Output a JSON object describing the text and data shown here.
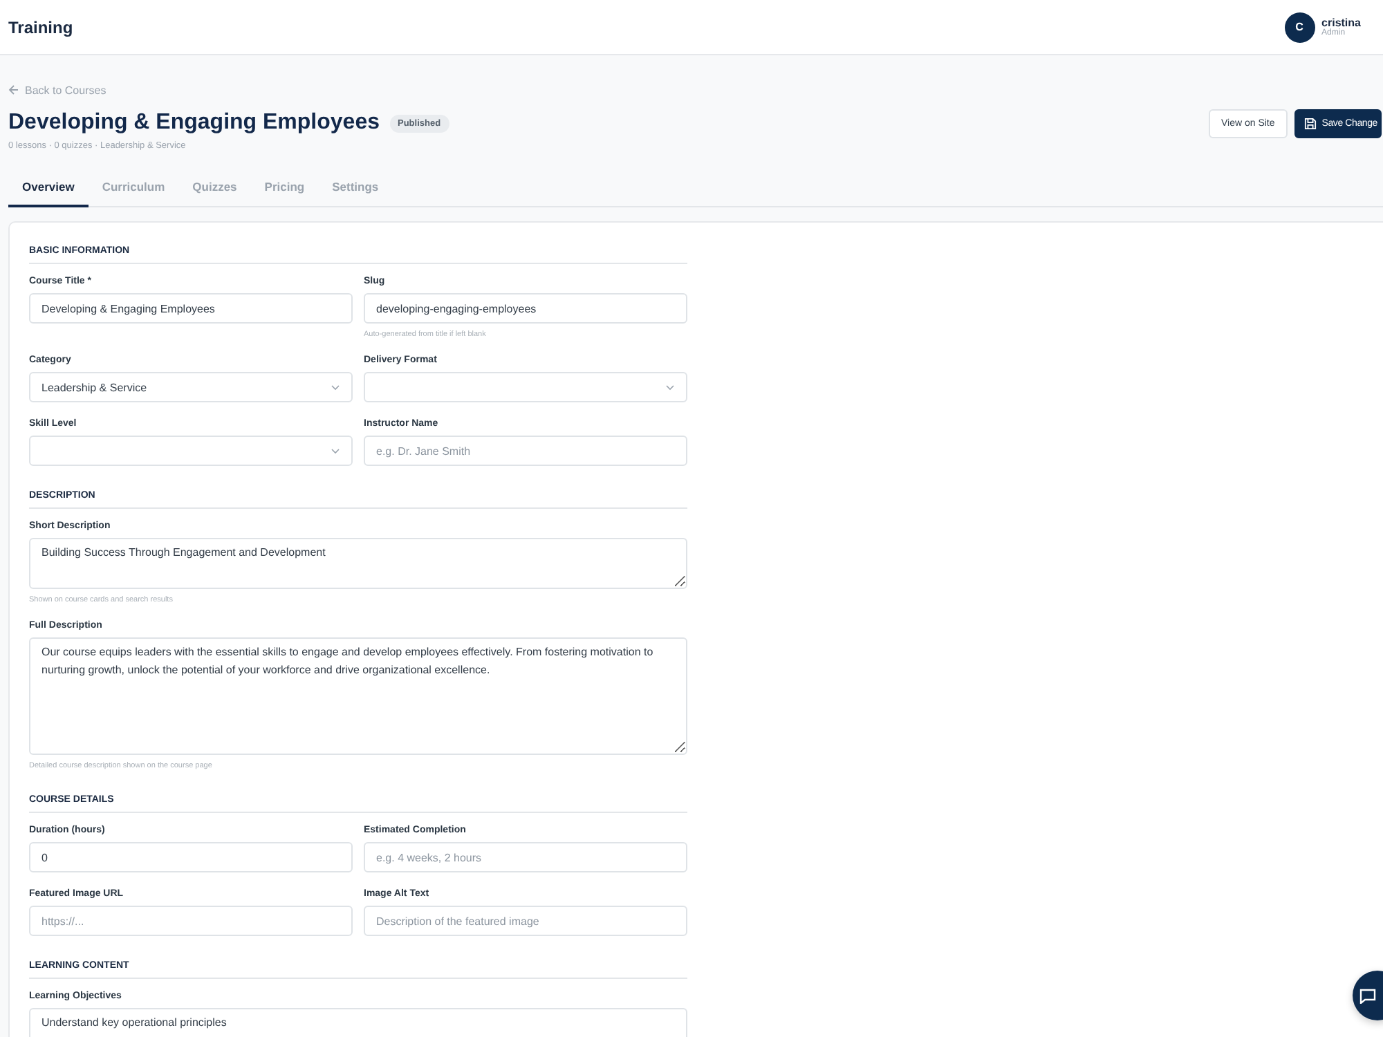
{
  "header": {
    "title": "Training",
    "user": {
      "initial": "C",
      "name": "cristina",
      "role": "Admin"
    }
  },
  "course": {
    "back": "Back to Courses",
    "title": "Developing & Engaging Employees",
    "status": "Published",
    "meta": "0 lessons · 0 quizzes · Leadership & Service",
    "actions": [
      {
        "label": "View on Site",
        "kind": "secondary"
      },
      {
        "label": "Save Change",
        "kind": "primary"
      }
    ]
  },
  "tabs": [
    {
      "label": "Overview",
      "selected": true
    },
    {
      "label": "Curriculum",
      "selected": false
    },
    {
      "label": "Quizzes",
      "selected": false
    },
    {
      "label": "Pricing",
      "selected": false
    },
    {
      "label": "Settings",
      "selected": false
    }
  ],
  "sections": [
    {
      "heading": "BASIC INFORMATION",
      "rows": [
        [
          {
            "label": "Course Title *",
            "kind": "text",
            "value": "Developing & Engaging Employees"
          },
          {
            "label": "Slug",
            "kind": "text",
            "value": "developing-engaging-employees",
            "help": "Auto-generated from title if left blank"
          }
        ],
        [
          {
            "label": "Category",
            "kind": "select",
            "value": "Leadership & Service"
          },
          {
            "label": "Delivery Format",
            "kind": "select"
          }
        ],
        [
          {
            "label": "Skill Level",
            "kind": "select"
          },
          {
            "label": "Instructor Name",
            "kind": "text",
            "placeholder": "e.g. Dr. Jane Smith"
          }
        ]
      ]
    },
    {
      "heading": "DESCRIPTION",
      "rows": [
        [
          {
            "label": "Short Description",
            "kind": "textarea",
            "value": "Building Success Through Engagement and Development",
            "help": "Shown on course cards and search results"
          }
        ],
        [
          {
            "label": "Full Description",
            "kind": "longtext",
            "value": "Our course equips leaders with the essential skills to engage and develop employees effectively. From fostering motivation to nurturing growth, unlock the potential of your workforce and drive organizational excellence.",
            "help": "Detailed course description shown on the course page"
          }
        ]
      ]
    },
    {
      "heading": "COURSE DETAILS",
      "rows": [
        [
          {
            "label": "Duration (hours)",
            "kind": "text",
            "value": "0"
          },
          {
            "label": "Estimated Completion",
            "kind": "text",
            "placeholder": "e.g. 4 weeks, 2 hours"
          }
        ],
        [
          {
            "label": "Featured Image URL",
            "kind": "text",
            "placeholder": "https://..."
          },
          {
            "label": "Image Alt Text",
            "kind": "text",
            "placeholder": "Description of the featured image"
          }
        ]
      ]
    },
    {
      "heading": "LEARNING CONTENT",
      "rows": [
        [
          {
            "label": "Learning Objectives",
            "kind": "textarea",
            "value": "Understand key operational principles"
          }
        ]
      ]
    }
  ]
}
